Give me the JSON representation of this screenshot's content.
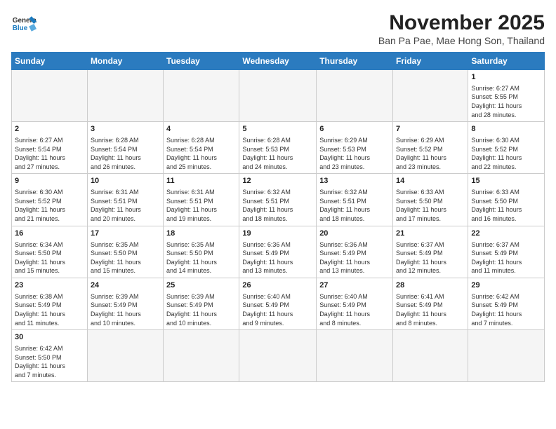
{
  "header": {
    "logo_general": "General",
    "logo_blue": "Blue",
    "month_title": "November 2025",
    "location": "Ban Pa Pae, Mae Hong Son, Thailand"
  },
  "weekdays": [
    "Sunday",
    "Monday",
    "Tuesday",
    "Wednesday",
    "Thursday",
    "Friday",
    "Saturday"
  ],
  "weeks": [
    [
      {
        "day": "",
        "info": ""
      },
      {
        "day": "",
        "info": ""
      },
      {
        "day": "",
        "info": ""
      },
      {
        "day": "",
        "info": ""
      },
      {
        "day": "",
        "info": ""
      },
      {
        "day": "",
        "info": ""
      },
      {
        "day": "1",
        "info": "Sunrise: 6:27 AM\nSunset: 5:55 PM\nDaylight: 11 hours\nand 28 minutes."
      }
    ],
    [
      {
        "day": "2",
        "info": "Sunrise: 6:27 AM\nSunset: 5:54 PM\nDaylight: 11 hours\nand 27 minutes."
      },
      {
        "day": "3",
        "info": "Sunrise: 6:28 AM\nSunset: 5:54 PM\nDaylight: 11 hours\nand 26 minutes."
      },
      {
        "day": "4",
        "info": "Sunrise: 6:28 AM\nSunset: 5:54 PM\nDaylight: 11 hours\nand 25 minutes."
      },
      {
        "day": "5",
        "info": "Sunrise: 6:28 AM\nSunset: 5:53 PM\nDaylight: 11 hours\nand 24 minutes."
      },
      {
        "day": "6",
        "info": "Sunrise: 6:29 AM\nSunset: 5:53 PM\nDaylight: 11 hours\nand 23 minutes."
      },
      {
        "day": "7",
        "info": "Sunrise: 6:29 AM\nSunset: 5:52 PM\nDaylight: 11 hours\nand 23 minutes."
      },
      {
        "day": "8",
        "info": "Sunrise: 6:30 AM\nSunset: 5:52 PM\nDaylight: 11 hours\nand 22 minutes."
      }
    ],
    [
      {
        "day": "9",
        "info": "Sunrise: 6:30 AM\nSunset: 5:52 PM\nDaylight: 11 hours\nand 21 minutes."
      },
      {
        "day": "10",
        "info": "Sunrise: 6:31 AM\nSunset: 5:51 PM\nDaylight: 11 hours\nand 20 minutes."
      },
      {
        "day": "11",
        "info": "Sunrise: 6:31 AM\nSunset: 5:51 PM\nDaylight: 11 hours\nand 19 minutes."
      },
      {
        "day": "12",
        "info": "Sunrise: 6:32 AM\nSunset: 5:51 PM\nDaylight: 11 hours\nand 18 minutes."
      },
      {
        "day": "13",
        "info": "Sunrise: 6:32 AM\nSunset: 5:51 PM\nDaylight: 11 hours\nand 18 minutes."
      },
      {
        "day": "14",
        "info": "Sunrise: 6:33 AM\nSunset: 5:50 PM\nDaylight: 11 hours\nand 17 minutes."
      },
      {
        "day": "15",
        "info": "Sunrise: 6:33 AM\nSunset: 5:50 PM\nDaylight: 11 hours\nand 16 minutes."
      }
    ],
    [
      {
        "day": "16",
        "info": "Sunrise: 6:34 AM\nSunset: 5:50 PM\nDaylight: 11 hours\nand 15 minutes."
      },
      {
        "day": "17",
        "info": "Sunrise: 6:35 AM\nSunset: 5:50 PM\nDaylight: 11 hours\nand 15 minutes."
      },
      {
        "day": "18",
        "info": "Sunrise: 6:35 AM\nSunset: 5:50 PM\nDaylight: 11 hours\nand 14 minutes."
      },
      {
        "day": "19",
        "info": "Sunrise: 6:36 AM\nSunset: 5:49 PM\nDaylight: 11 hours\nand 13 minutes."
      },
      {
        "day": "20",
        "info": "Sunrise: 6:36 AM\nSunset: 5:49 PM\nDaylight: 11 hours\nand 13 minutes."
      },
      {
        "day": "21",
        "info": "Sunrise: 6:37 AM\nSunset: 5:49 PM\nDaylight: 11 hours\nand 12 minutes."
      },
      {
        "day": "22",
        "info": "Sunrise: 6:37 AM\nSunset: 5:49 PM\nDaylight: 11 hours\nand 11 minutes."
      }
    ],
    [
      {
        "day": "23",
        "info": "Sunrise: 6:38 AM\nSunset: 5:49 PM\nDaylight: 11 hours\nand 11 minutes."
      },
      {
        "day": "24",
        "info": "Sunrise: 6:39 AM\nSunset: 5:49 PM\nDaylight: 11 hours\nand 10 minutes."
      },
      {
        "day": "25",
        "info": "Sunrise: 6:39 AM\nSunset: 5:49 PM\nDaylight: 11 hours\nand 10 minutes."
      },
      {
        "day": "26",
        "info": "Sunrise: 6:40 AM\nSunset: 5:49 PM\nDaylight: 11 hours\nand 9 minutes."
      },
      {
        "day": "27",
        "info": "Sunrise: 6:40 AM\nSunset: 5:49 PM\nDaylight: 11 hours\nand 8 minutes."
      },
      {
        "day": "28",
        "info": "Sunrise: 6:41 AM\nSunset: 5:49 PM\nDaylight: 11 hours\nand 8 minutes."
      },
      {
        "day": "29",
        "info": "Sunrise: 6:42 AM\nSunset: 5:49 PM\nDaylight: 11 hours\nand 7 minutes."
      }
    ],
    [
      {
        "day": "30",
        "info": "Sunrise: 6:42 AM\nSunset: 5:50 PM\nDaylight: 11 hours\nand 7 minutes."
      },
      {
        "day": "",
        "info": ""
      },
      {
        "day": "",
        "info": ""
      },
      {
        "day": "",
        "info": ""
      },
      {
        "day": "",
        "info": ""
      },
      {
        "day": "",
        "info": ""
      },
      {
        "day": "",
        "info": ""
      }
    ]
  ]
}
